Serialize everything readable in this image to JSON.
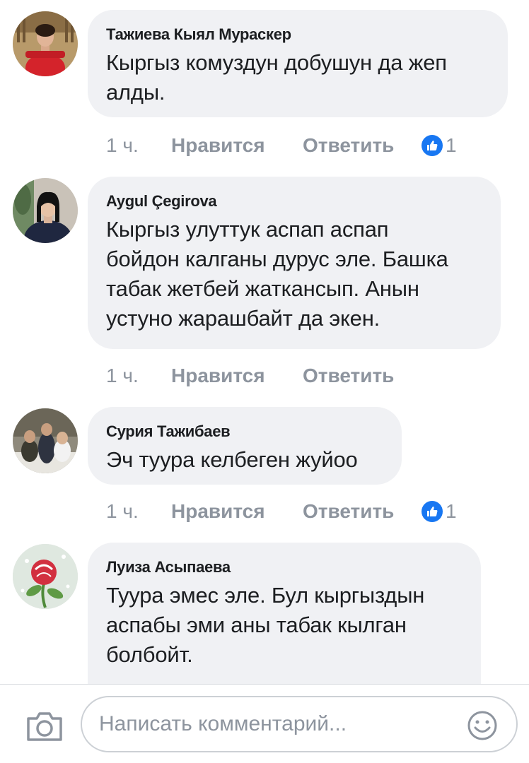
{
  "comments": [
    {
      "author": "Тажиева Кыял Мураскер",
      "text_lines": [
        "Кыргыз комуздун добушун да жеп",
        "алды."
      ],
      "time": "1 ч.",
      "like_label": "Нравится",
      "reply_label": "Ответить",
      "reaction_count": "1",
      "avatar_colors": {
        "bg": "#b89a6a",
        "accent": "#d4232b"
      }
    },
    {
      "author": "Aygul Çegirova",
      "text_lines": [
        "Кыргыз улуттук аспап аспап",
        "бойдон калганы дурус эле. Башка",
        "табак жетбей жаткансып. Анын",
        "устуно жарашбайт да экен."
      ],
      "time": "1 ч.",
      "like_label": "Нравится",
      "reply_label": "Ответить",
      "reaction_count": "",
      "avatar_colors": {
        "bg": "#c9c2b8",
        "accent": "#1f2740"
      }
    },
    {
      "author": "Сурия Тажибаев",
      "text_lines": [
        "Эч туура келбеген жуйоо"
      ],
      "time": "1 ч.",
      "like_label": "Нравится",
      "reply_label": "Ответить",
      "reaction_count": "1",
      "avatar_colors": {
        "bg": "#8f8a7c",
        "accent": "#3b3a30"
      }
    },
    {
      "author": "Луиза Асыпаева",
      "text_lines": [
        "Туура эмес эле. Бул кыргыздын",
        "аспабы эми аны табак кылган",
        "болбойт."
      ],
      "time": "",
      "like_label": "",
      "reply_label": "",
      "reaction_count": "",
      "avatar_colors": {
        "bg": "#dfe8e0",
        "accent": "#d23040"
      }
    }
  ],
  "composer": {
    "placeholder": "Написать комментарий...",
    "camera_icon": "camera-icon",
    "emoji_icon": "emoji-icon"
  },
  "colors": {
    "bubble": "#f0f1f4",
    "meta_text": "#8d949e",
    "like_badge": "#1877f2",
    "name_text": "#1c1e21"
  }
}
